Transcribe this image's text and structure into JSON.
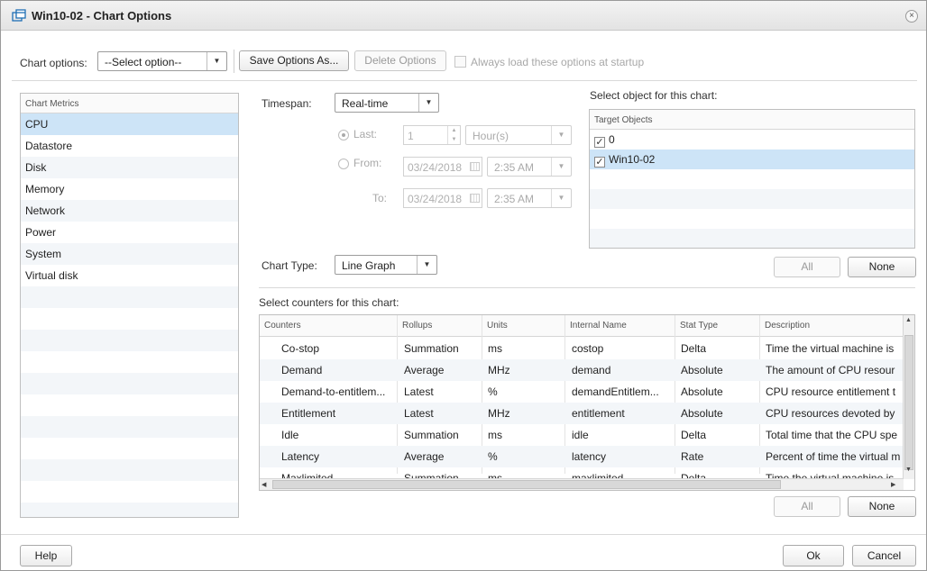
{
  "window": {
    "title": "Win10-02 - Chart Options",
    "close_symbol": "×"
  },
  "toolbar": {
    "chart_options_label": "Chart options:",
    "select_placeholder": "--Select option--",
    "save_label": "Save Options As...",
    "delete_label": "Delete Options",
    "always_load_label": "Always load these options at startup"
  },
  "metrics": {
    "header": "Chart Metrics",
    "items": [
      "CPU",
      "Datastore",
      "Disk",
      "Memory",
      "Network",
      "Power",
      "System",
      "Virtual disk"
    ],
    "selected": "CPU"
  },
  "timespan": {
    "label": "Timespan:",
    "value": "Real-time",
    "last_label": "Last:",
    "last_value": "1",
    "last_unit": "Hour(s)",
    "from_label": "From:",
    "from_date": "03/24/2018",
    "from_time": "2:35 AM",
    "to_label": "To:",
    "to_date": "03/24/2018",
    "to_time": "2:35 AM"
  },
  "chart_type": {
    "label": "Chart Type:",
    "value": "Line Graph"
  },
  "objects": {
    "label": "Select object for this chart:",
    "header": "Target Objects",
    "items": [
      {
        "name": "0",
        "checked": true
      },
      {
        "name": "Win10-02",
        "checked": true
      }
    ],
    "all_label": "All",
    "none_label": "None"
  },
  "counters": {
    "label": "Select counters for this chart:",
    "columns": [
      "Counters",
      "Rollups",
      "Units",
      "Internal Name",
      "Stat Type",
      "Description"
    ],
    "rows": [
      [
        "Co-stop",
        "Summation",
        "ms",
        "costop",
        "Delta",
        "Time the virtual machine is"
      ],
      [
        "Demand",
        "Average",
        "MHz",
        "demand",
        "Absolute",
        "The amount of CPU resour"
      ],
      [
        "Demand-to-entitlem...",
        "Latest",
        "%",
        "demandEntitlem...",
        "Absolute",
        "CPU resource entitlement t"
      ],
      [
        "Entitlement",
        "Latest",
        "MHz",
        "entitlement",
        "Absolute",
        "CPU resources devoted by"
      ],
      [
        "Idle",
        "Summation",
        "ms",
        "idle",
        "Delta",
        "Total time that the CPU spe"
      ],
      [
        "Latency",
        "Average",
        "%",
        "latency",
        "Rate",
        "Percent of time the virtual m"
      ],
      [
        "Maxlimited",
        "Summation",
        "ms",
        "maxlimited",
        "Delta",
        "Time the virtual machine is"
      ]
    ],
    "all_label": "All",
    "none_label": "None"
  },
  "footer": {
    "help_label": "Help",
    "ok_label": "Ok",
    "cancel_label": "Cancel"
  },
  "colors": {
    "selection": "#cde4f7",
    "alt_row": "#f3f6f9",
    "title_icon": "#1f6fb5"
  }
}
